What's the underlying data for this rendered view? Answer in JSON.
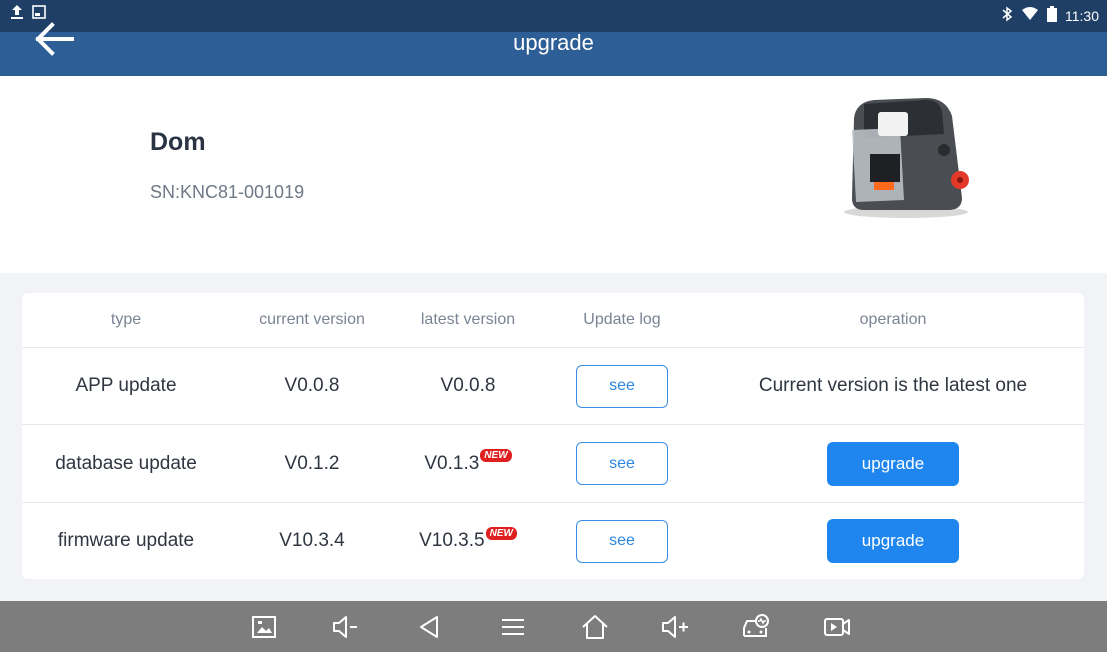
{
  "status": {
    "time": "11:30"
  },
  "appbar": {
    "title": "upgrade"
  },
  "device": {
    "name": "Dom",
    "sn": "SN:KNC81-001019"
  },
  "table": {
    "headers": [
      "type",
      "current version",
      "latest version",
      "Update log",
      "operation"
    ],
    "rows": [
      {
        "type": "APP update",
        "current": "V0.0.8",
        "latest": "V0.0.8",
        "is_new": false,
        "log": "see",
        "operation": "Current version is the latest one"
      },
      {
        "type": "database update",
        "current": "V0.1.2",
        "latest": "V0.1.3",
        "is_new": true,
        "badge": "NEW",
        "log": "see",
        "operation": "upgrade"
      },
      {
        "type": "firmware update",
        "current": "V10.3.4",
        "latest": "V10.3.5",
        "is_new": true,
        "badge": "NEW",
        "log": "see",
        "operation": "upgrade"
      }
    ]
  },
  "navbar": {
    "icons": [
      "screenshot-icon",
      "volume-down-icon",
      "back-triangle-icon",
      "menu-icon",
      "home-icon",
      "volume-up-icon",
      "vehicle-diagnostic-icon",
      "screen-record-icon"
    ]
  },
  "colors": {
    "statusbar": "#1f3f66",
    "appbar": "#2e5e96",
    "accent": "#1f86f0",
    "badge": "#e02020",
    "navbar": "#7d7d7d"
  }
}
